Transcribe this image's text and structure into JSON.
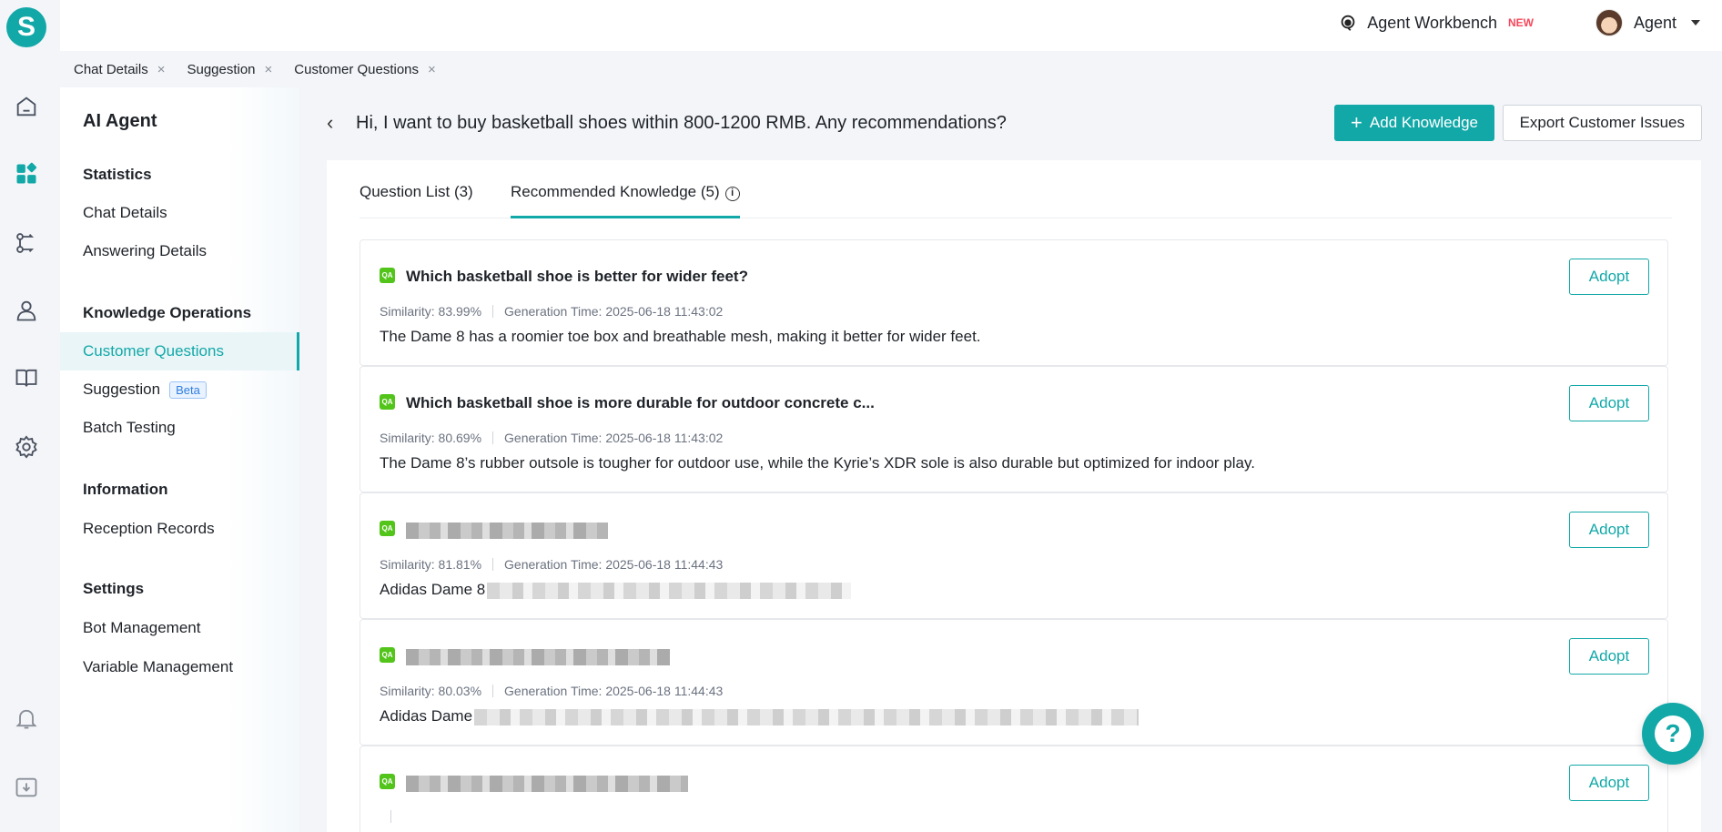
{
  "app": {
    "logo_letter": "S"
  },
  "topbar": {
    "workbench_label": "Agent Workbench",
    "new_badge": "NEW",
    "user_name": "Agent"
  },
  "tabs": [
    {
      "label": "Chat Details",
      "close": "×"
    },
    {
      "label": "Suggestion",
      "close": "×"
    },
    {
      "label": "Customer Questions",
      "close": "×"
    }
  ],
  "sidebar": {
    "title": "AI Agent",
    "groups": [
      {
        "label": "Statistics",
        "items": [
          "Chat Details",
          "Answering Details"
        ]
      },
      {
        "label": "Knowledge Operations",
        "items": [
          "Customer Questions",
          "Suggestion",
          "Batch Testing"
        ]
      },
      {
        "label": "Information",
        "items": [
          "Reception Records"
        ]
      },
      {
        "label": "Settings",
        "items": [
          "Bot Management",
          "Variable Management"
        ]
      }
    ],
    "active_item": "Customer Questions",
    "beta_badge": "Beta"
  },
  "header": {
    "title": "Hi, I want to buy basketball shoes within 800-1200 RMB. Any recommendations?",
    "add_button": "Add Knowledge",
    "export_button": "Export Customer Issues"
  },
  "panel_tabs": [
    {
      "label": "Question List (3)",
      "active": false
    },
    {
      "label": "Recommended Knowledge (5)",
      "active": true
    }
  ],
  "cards": [
    {
      "badge": "QA",
      "title": "Which basketball shoe is better for wider feet?",
      "similarity": "Similarity: 83.99%",
      "generation_time": "Generation Time: 2025-06-18 11:43:02",
      "answer": "The Dame 8 has a roomier toe box and breathable mesh, making it better for wider feet.",
      "adopt": "Adopt"
    },
    {
      "badge": "QA",
      "title": "Which basketball shoe is more durable for outdoor concrete c...",
      "similarity": "Similarity: 80.69%",
      "generation_time": "Generation Time: 2025-06-18 11:43:02",
      "answer": "The Dame 8’s rubber outsole is tougher for outdoor use, while the Kyrie’s XDR sole is also durable but optimized for indoor play.",
      "adopt": "Adopt"
    },
    {
      "badge": "QA",
      "title": "",
      "similarity": "Similarity: 81.81%",
      "generation_time": "Generation Time: 2025-06-18 11:44:43",
      "answer": "Adidas Dame 8",
      "adopt": "Adopt"
    },
    {
      "badge": "QA",
      "title": "",
      "similarity": "Similarity: 80.03%",
      "generation_time": "Generation Time: 2025-06-18 11:44:43",
      "answer": "Adidas Dame",
      "adopt": "Adopt"
    },
    {
      "badge": "QA",
      "title": "",
      "similarity": "",
      "generation_time": "",
      "answer": "",
      "adopt": "Adopt"
    }
  ],
  "help_button": "?",
  "colors": {
    "accent": "#13a8a8",
    "qa_badge": "#52c41a",
    "new_badge": "#f5475b",
    "beta_badge": "#2f7fe0"
  }
}
